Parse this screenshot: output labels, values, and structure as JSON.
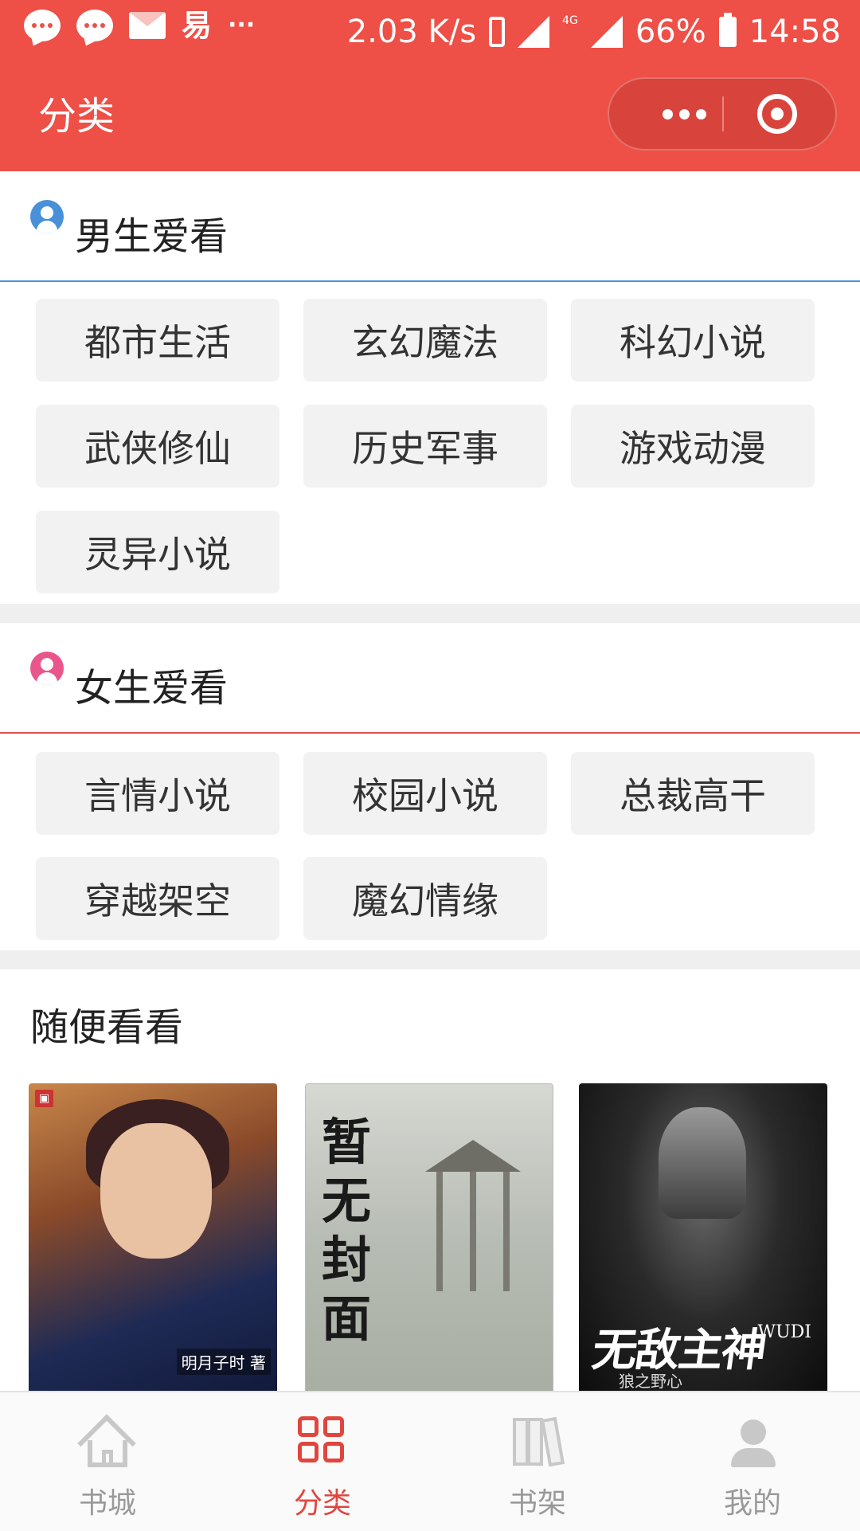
{
  "status_bar": {
    "speed": "2.03 K/s",
    "dots": "···",
    "network": "4G",
    "battery": "66%",
    "time": "14:58",
    "app_glyph": "易"
  },
  "header": {
    "title": "分类",
    "background": "#ee4f46"
  },
  "sections": {
    "male": {
      "title": "男生爱看",
      "icon": "male-user-icon",
      "accent": "#4a90d9",
      "tags": [
        "都市生活",
        "玄幻魔法",
        "科幻小说",
        "武侠修仙",
        "历史军事",
        "游戏动漫",
        "灵异小说"
      ]
    },
    "female": {
      "title": "女生爱看",
      "icon": "female-user-icon",
      "accent": "#e9568c",
      "tags": [
        "言情小说",
        "校园小说",
        "总裁高干",
        "穿越架空",
        "魔幻情缘"
      ]
    }
  },
  "browse": {
    "title": "随便看看",
    "books": [
      {
        "cover_text": "明月子时 著"
      },
      {
        "cover_text": "暂无封面"
      },
      {
        "cover_text": "无敌主神",
        "cover_sub": "狼之野心",
        "cover_en": "WUDI"
      }
    ]
  },
  "tabbar": {
    "tabs": [
      "书城",
      "分类",
      "书架",
      "我的"
    ],
    "active": "分类",
    "active_color": "#e0463e"
  }
}
